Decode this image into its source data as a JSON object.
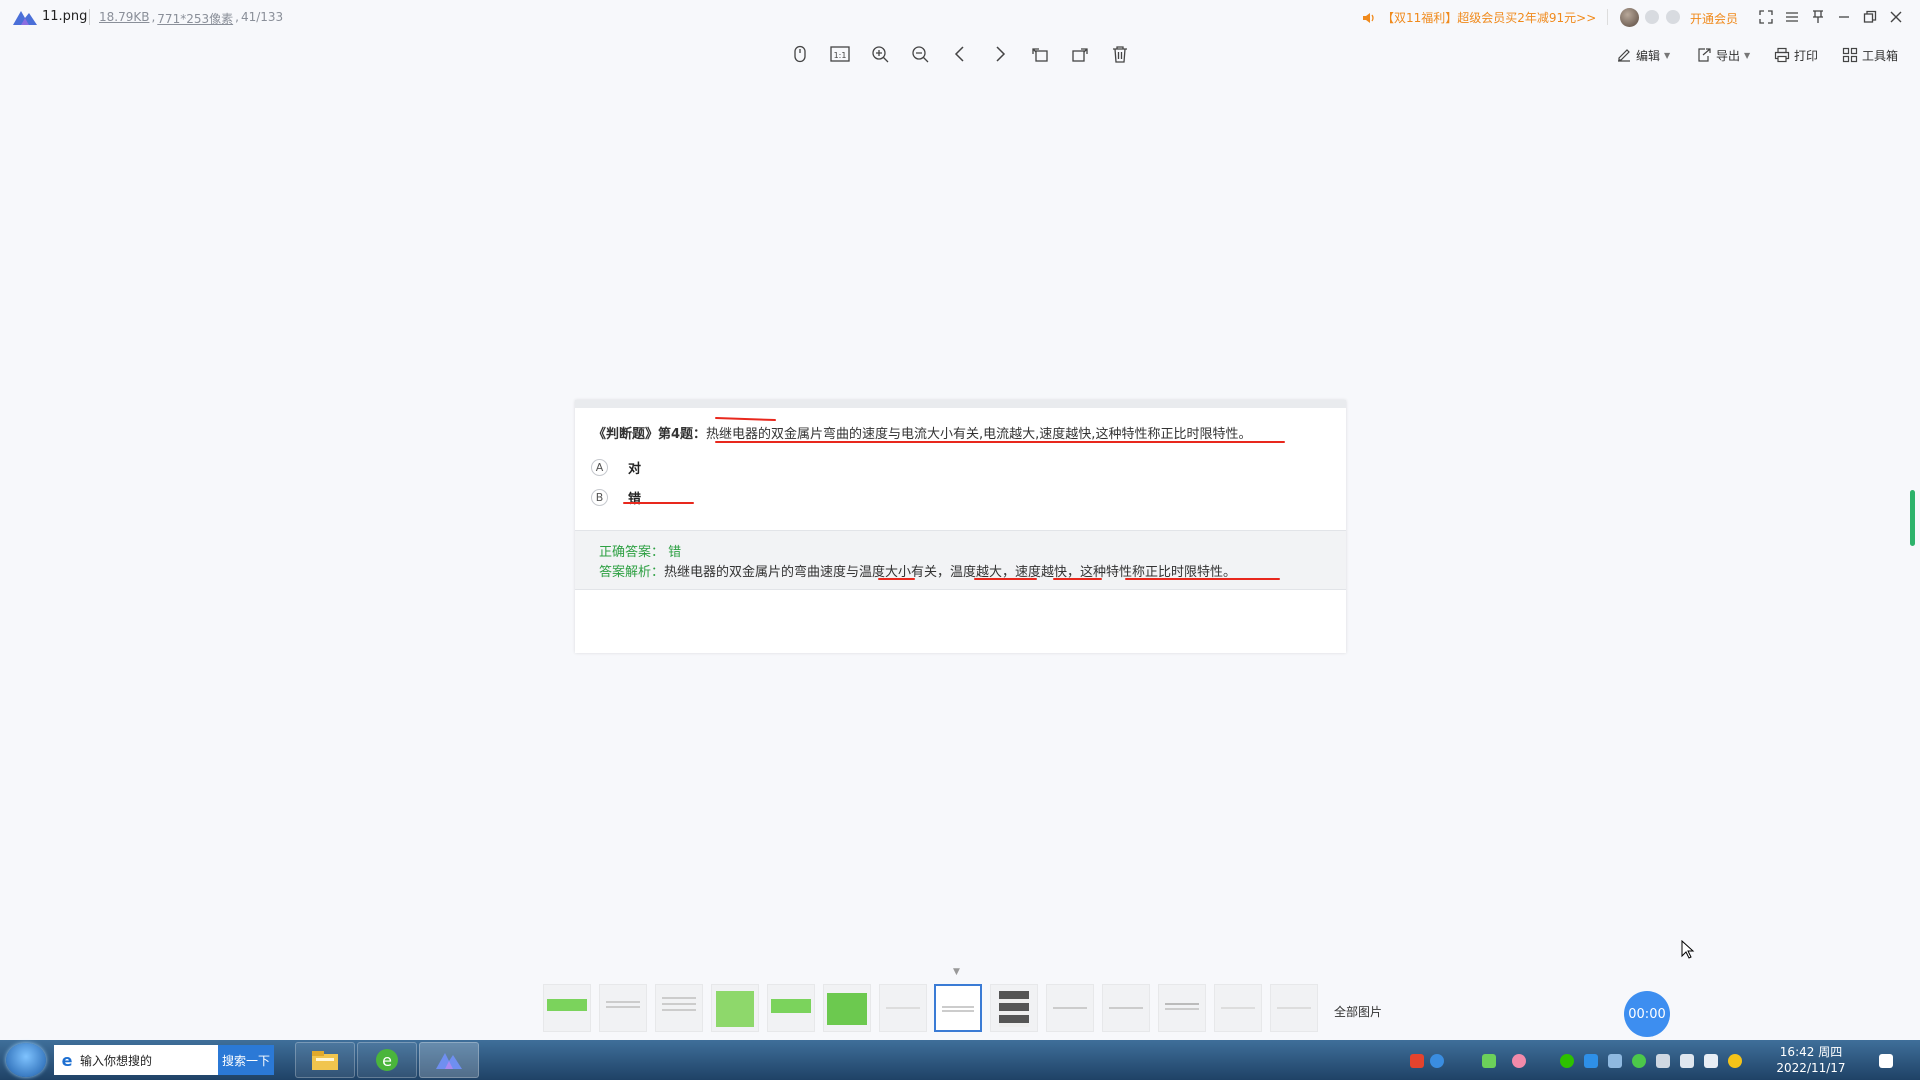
{
  "window": {
    "file_name": "11.png",
    "file_size": "18.79KB",
    "dimensions": "771*253像素",
    "position": "41/133",
    "promo": "【双11福利】超级会员买2年减91元>>",
    "vip_label": "开通会员"
  },
  "toolbar_right": {
    "edit_label": "编辑",
    "export_label": "导出",
    "print_label": "打印",
    "toolbox_label": "工具箱"
  },
  "question": {
    "label": "《判断题》第4题：",
    "text": "热继电器的双金属片弯曲的速度与电流大小有关,电流越大,速度越快,这种特性称正比时限特性。",
    "options": [
      {
        "letter": "A",
        "text": "对"
      },
      {
        "letter": "B",
        "text": "错"
      }
    ],
    "answer_label": "正确答案：",
    "answer_value": "错",
    "analysis_label": "答案解析：",
    "analysis_text": "热继电器的双金属片的弯曲速度与温度大小有关，温度越大，速度越快，这种特性称正比时限特性。"
  },
  "filmstrip": {
    "all_images_label": "全部图片",
    "timer": "00:00"
  },
  "taskbar": {
    "search_placeholder": "输入你想搜的",
    "search_button": "搜索一下",
    "time": "16:42 周四",
    "date": "2022/11/17"
  },
  "colors": {
    "accent_orange": "#f08a1c",
    "answer_green": "#2ea043",
    "ink_red": "#e8281d",
    "selected_blue": "#3a7bd5"
  }
}
